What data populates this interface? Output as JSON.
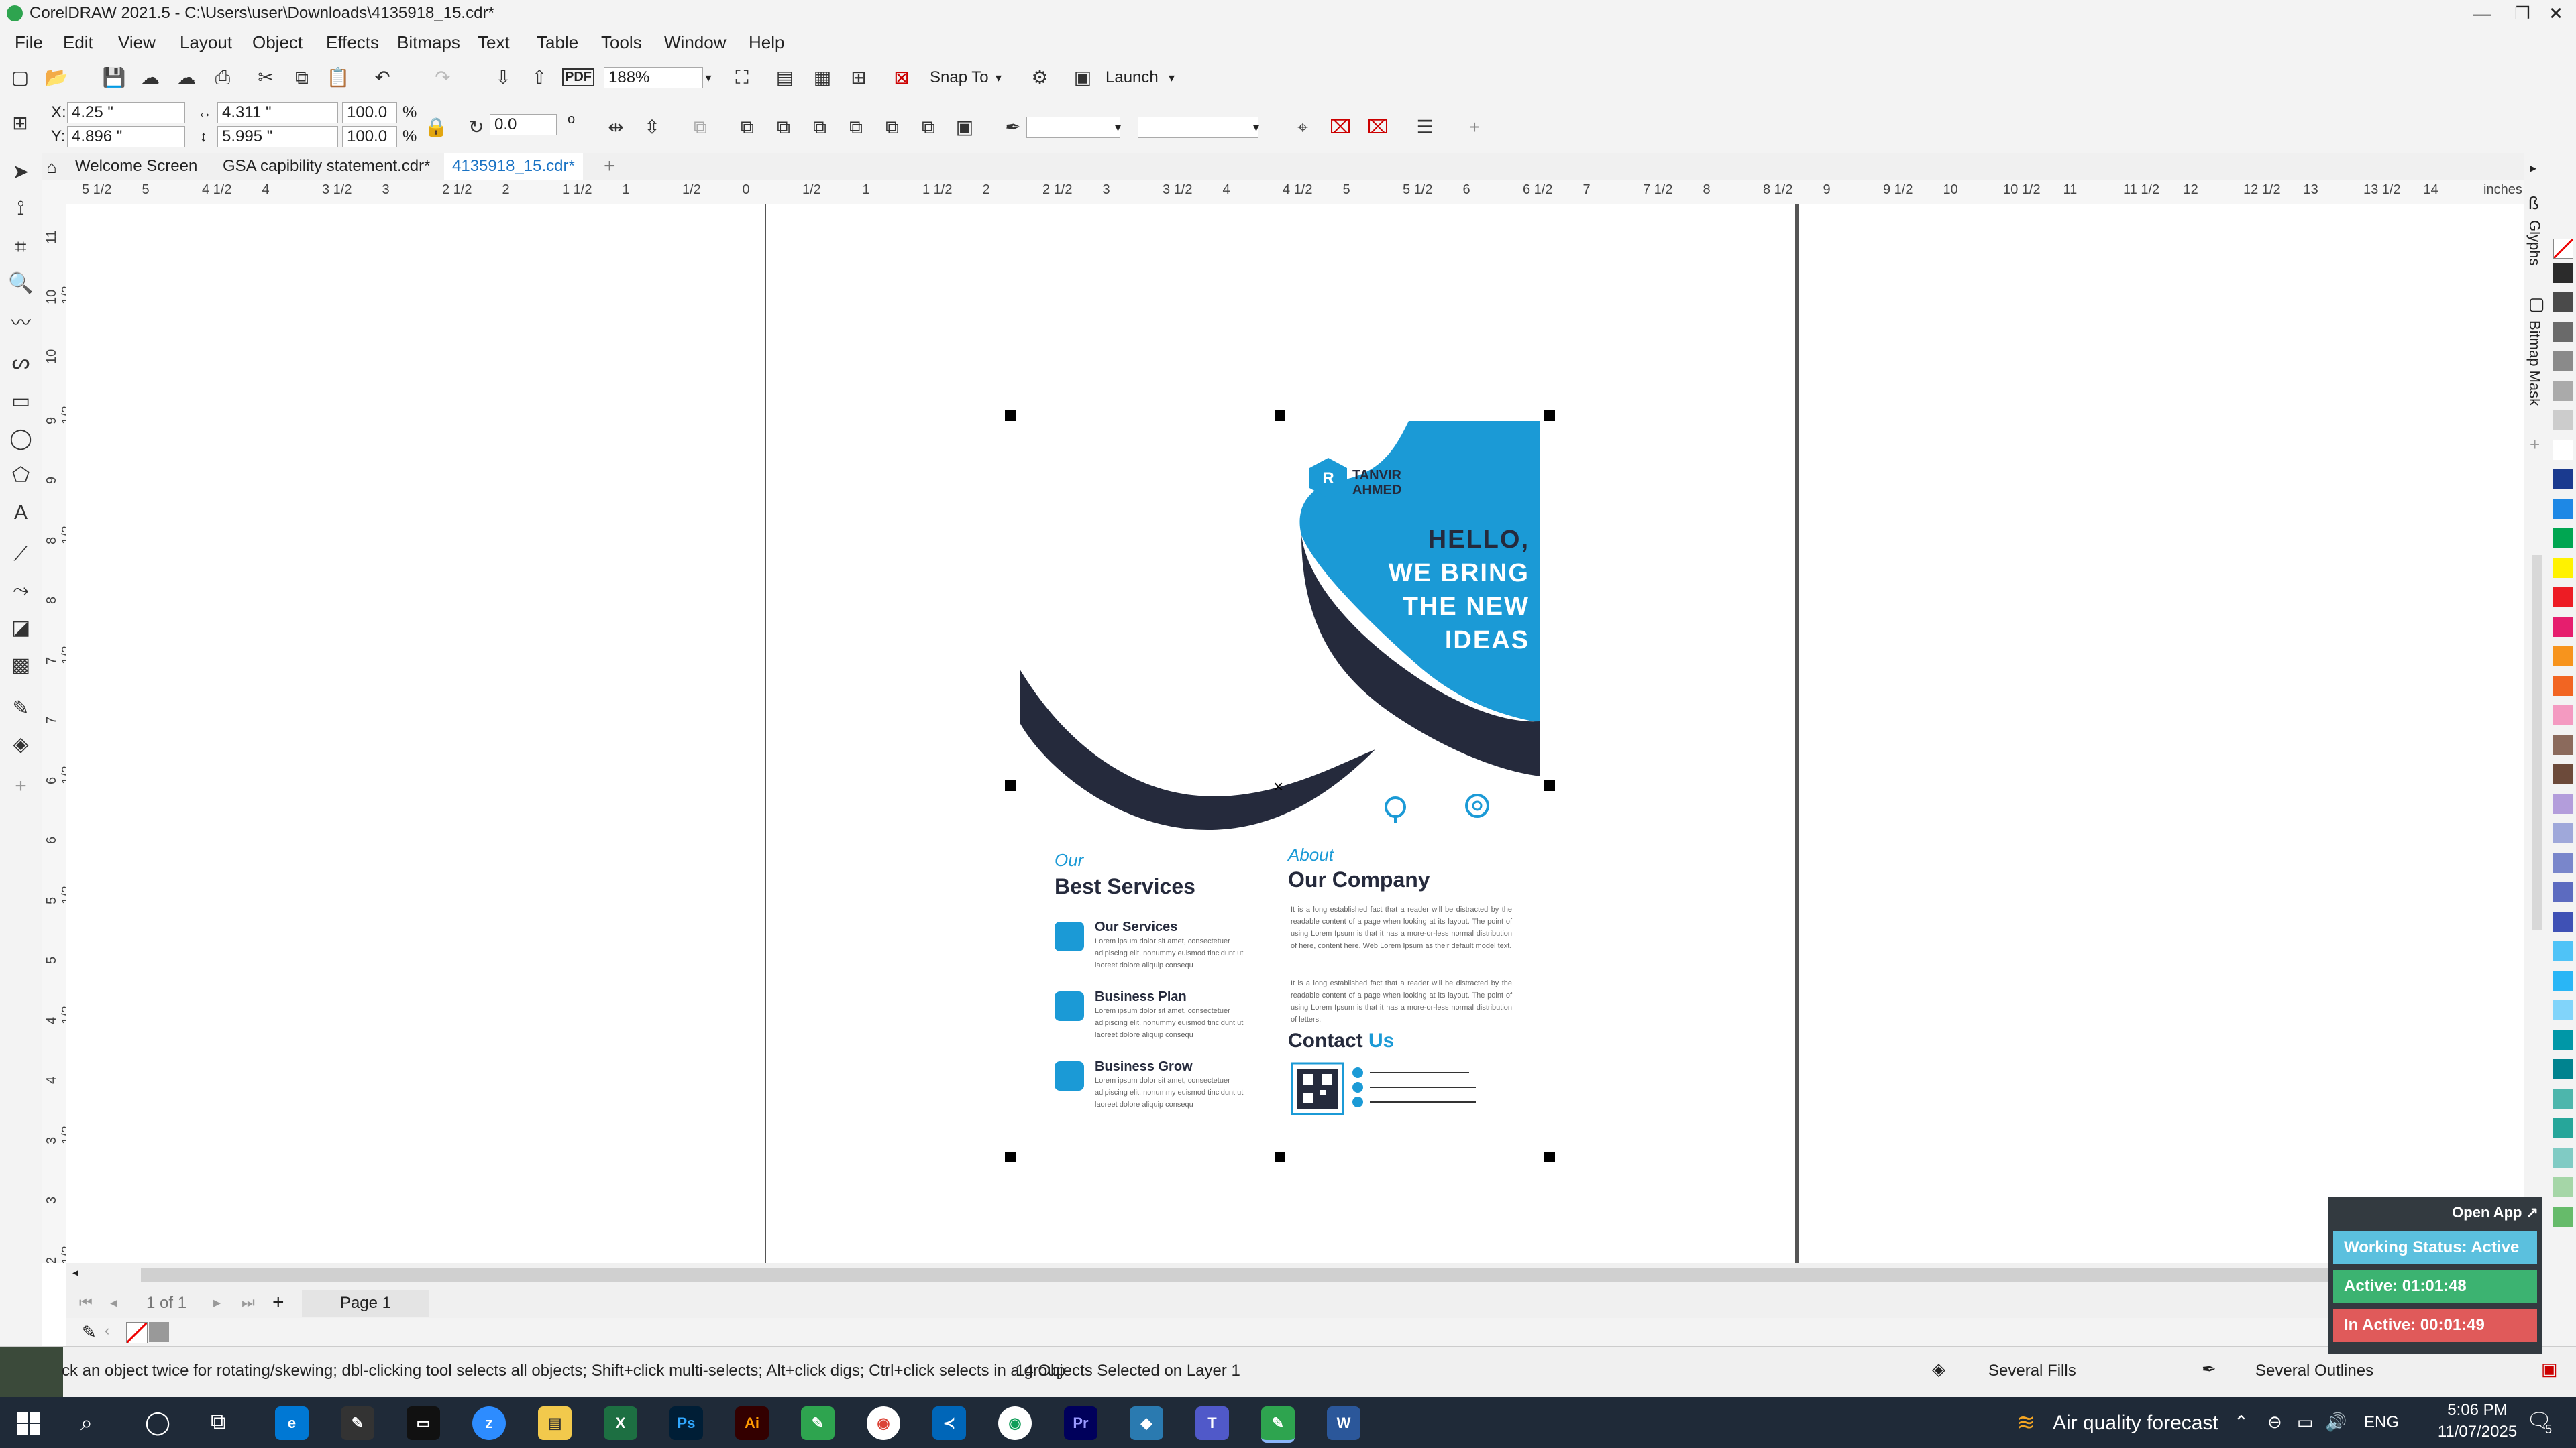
{
  "window": {
    "title": "CorelDRAW 2021.5 - C:\\Users\\user\\Downloads\\4135918_15.cdr*",
    "minimize": "—",
    "maximize": "❐",
    "close": "✕"
  },
  "menu": [
    "File",
    "Edit",
    "View",
    "Layout",
    "Object",
    "Effects",
    "Bitmaps",
    "Text",
    "Table",
    "Tools",
    "Window",
    "Help"
  ],
  "toolbar": {
    "zoom": "188%",
    "snap_to": "Snap To",
    "launch": "Launch",
    "pdf_label": "PDF"
  },
  "property_bar": {
    "x_label": "X:",
    "x": "4.25 \"",
    "y_label": "Y:",
    "y": "4.896 \"",
    "width": "4.311 \"",
    "height": "5.995 \"",
    "scale_w": "100.0",
    "scale_h": "100.0",
    "percent": "%",
    "rotation": "0.0",
    "degree": "o"
  },
  "tabs": {
    "welcome": "Welcome Screen",
    "doc1": "GSA   capibility statement.cdr*",
    "doc2": "4135918_15.cdr*",
    "add": "+"
  },
  "ruler": {
    "unit": "inches",
    "ticks": [
      "5 1/2",
      "5",
      "4 1/2",
      "4",
      "3 1/2",
      "3",
      "2 1/2",
      "2",
      "1 1/2",
      "1",
      "1/2",
      "0",
      "1/2",
      "1",
      "1 1/2",
      "2",
      "2 1/2",
      "3",
      "3 1/2",
      "4",
      "4 1/2",
      "5",
      "5 1/2",
      "6",
      "6 1/2",
      "7",
      "7 1/2",
      "8",
      "8 1/2",
      "9",
      "9 1/2",
      "10",
      "10 1/2",
      "11",
      "11 1/2",
      "12",
      "12 1/2",
      "13",
      "13 1/2",
      "14"
    ],
    "vticks": [
      "11",
      "10 1/2",
      "10",
      "9 1/2",
      "9",
      "8 1/2",
      "8",
      "7 1/2",
      "7",
      "6 1/2",
      "6",
      "5 1/2",
      "5",
      "4 1/2",
      "4",
      "3 1/2",
      "3",
      "2 1/2"
    ]
  },
  "design": {
    "logo_line1": "TANVIR",
    "logo_line2": "AHMED",
    "headline": [
      "HELLO,",
      "WE BRING",
      "THE NEW",
      "IDEAS"
    ],
    "services_kicker": "Our",
    "services_title": "Best Services",
    "services": [
      {
        "title": "Our Services",
        "text": "Lorem ipsum dolor sit amet, consectetuer adipiscing elit, nonummy euismod tincidunt ut laoreet dolore aliquip consequ"
      },
      {
        "title": "Business Plan",
        "text": "Lorem ipsum dolor sit amet, consectetuer adipiscing elit, nonummy euismod tincidunt ut laoreet dolore aliquip consequ"
      },
      {
        "title": "Business Grow",
        "text": "Lorem ipsum dolor sit amet, consectetuer adipiscing elit, nonummy euismod tincidunt ut laoreet dolore aliquip consequ"
      }
    ],
    "about_kicker": "About",
    "about_title": "Our Company",
    "about_p1": "It is a long established fact that a reader will be distracted by the readable content of a page when looking at its layout. The point of using Lorem Ipsum is that it has a more-or-less normal distribution of here, content here. Web Lorem Ipsum as their default model text.",
    "about_p2": "It is a long established fact that a reader will be distracted by the readable content of a page when looking at its layout. The point of using Lorem Ipsum is that it has a more-or-less normal distribution of letters.",
    "contact_a": "Contact",
    "contact_b": "Us"
  },
  "dockers": {
    "glyphs": "Glyphs",
    "bitmap_mask": "Bitmap Mask"
  },
  "palette": [
    "#2b2b2b",
    "#4a4a4a",
    "#6a6a6a",
    "#8a8a8a",
    "#aaaaaa",
    "#cccccc",
    "#ffffff",
    "#1a3a8f",
    "#1e88e5",
    "#00a651",
    "#fff200",
    "#ed1c24",
    "#e61e6e",
    "#f7941d",
    "#f26522",
    "#f49ac1",
    "#8b6a5c",
    "#6c4a3a",
    "#b39ddb",
    "#9fa8da",
    "#7986cb",
    "#5c6bc0",
    "#3f51b5",
    "#4fc3f7",
    "#29b6f6",
    "#81d4fa",
    "#0097a7",
    "#00838f",
    "#4db6ac",
    "#26a69a",
    "#80cbc4",
    "#a5d6a7",
    "#66bb6a"
  ],
  "pages": {
    "counter": "1 of 1",
    "tab": "Page 1"
  },
  "status": {
    "hint": "ck an object twice for rotating/skewing; dbl-clicking tool selects all objects; Shift+click multi-selects; Alt+click digs; Ctrl+click selects in a group",
    "selection": "14 Objects Selected on Layer 1",
    "fill": "Several Fills",
    "outline": "Several Outlines"
  },
  "tracker": {
    "open_app": "Open App ↗",
    "working": "Working Status: Active",
    "active": "Active: 01:01:48",
    "inactive": "In Active: 00:01:49",
    "colors": {
      "working": "#5bc0de",
      "active": "#3cb371",
      "inactive": "#e05a5a"
    }
  },
  "taskbar": {
    "weather": "Air quality forecast",
    "lang": "ENG",
    "time": "5:06 PM",
    "date": "11/07/2025",
    "notifications": "5"
  },
  "brand": {
    "blue": "#1b9ad6",
    "navy": "#252a3c"
  }
}
